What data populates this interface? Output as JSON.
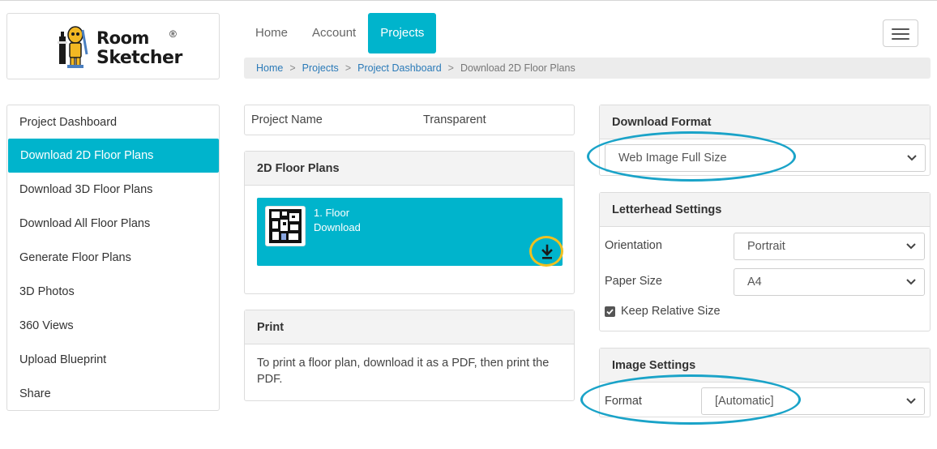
{
  "brand": {
    "word1": "Room",
    "word2": "Sketcher",
    "registered": "®"
  },
  "topnav": {
    "items": [
      {
        "label": "Home",
        "active": false
      },
      {
        "label": "Account",
        "active": false
      },
      {
        "label": "Projects",
        "active": true
      }
    ],
    "menu_icon": "hamburger-icon"
  },
  "breadcrumb": {
    "items": [
      "Home",
      "Projects",
      "Project Dashboard",
      "Download 2D Floor Plans"
    ],
    "separator": ">"
  },
  "sidebar": {
    "items": [
      {
        "label": "Project Dashboard",
        "active": false
      },
      {
        "label": "Download 2D Floor Plans",
        "active": true
      },
      {
        "label": "Download 3D Floor Plans",
        "active": false
      },
      {
        "label": "Download All Floor Plans",
        "active": false
      },
      {
        "label": "Generate Floor Plans",
        "active": false
      },
      {
        "label": "3D Photos",
        "active": false
      },
      {
        "label": "360 Views",
        "active": false
      },
      {
        "label": "Upload Blueprint",
        "active": false
      },
      {
        "label": "Share",
        "active": false
      }
    ]
  },
  "project": {
    "name_label": "Project Name",
    "name_value": "Transparent"
  },
  "floor_plans": {
    "title": "2D Floor Plans",
    "items": [
      {
        "name": "1. Floor",
        "action": "Download",
        "icon": "download-icon"
      }
    ]
  },
  "print": {
    "title": "Print",
    "text": "To print a floor plan, download it as a PDF, then print the PDF."
  },
  "download_format": {
    "title": "Download Format",
    "selected": "Web Image Full Size"
  },
  "letterhead": {
    "title": "Letterhead Settings",
    "orientation_label": "Orientation",
    "orientation_value": "Portrait",
    "paper_label": "Paper Size",
    "paper_value": "A4",
    "keep_label": "Keep Relative Size",
    "keep_checked": true
  },
  "image_settings": {
    "title": "Image Settings",
    "format_label": "Format",
    "format_value": "[Automatic]"
  },
  "colors": {
    "accent": "#00b4cc",
    "annotation_blue": "#1aa3c8",
    "annotation_yellow": "#f0c020"
  }
}
